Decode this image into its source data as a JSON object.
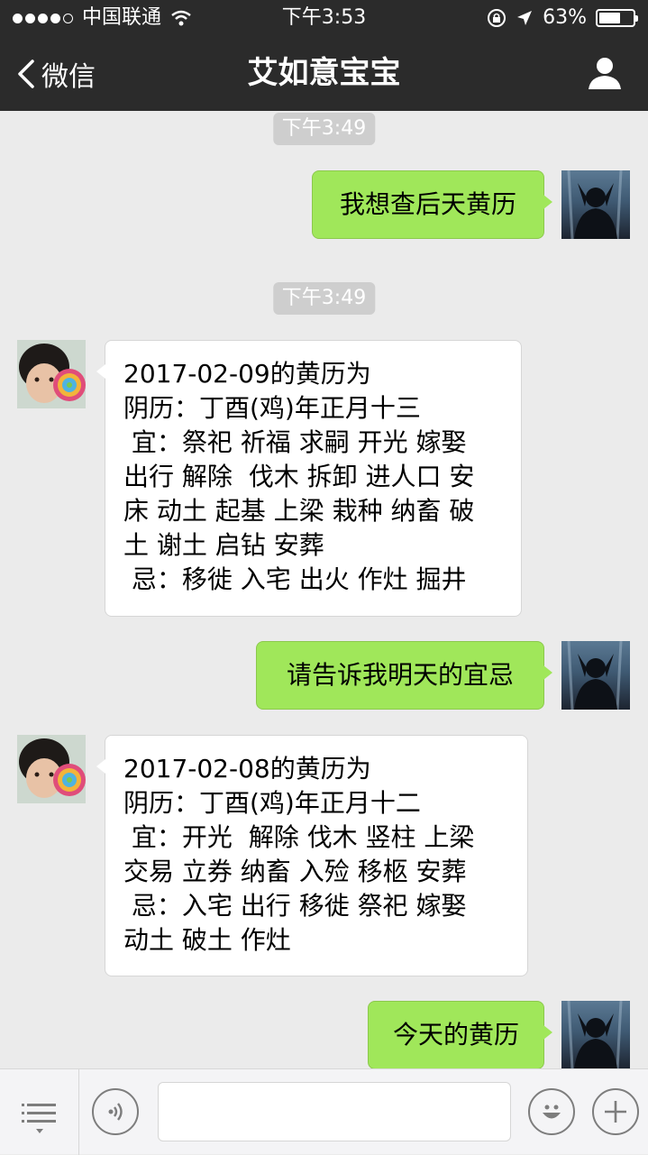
{
  "status_bar": {
    "carrier": "中国联通",
    "time": "下午3:53",
    "battery": "63%",
    "battery_level": 0.63,
    "signal_bars": 4
  },
  "nav": {
    "back_label": "微信",
    "title": "艾如意宝宝"
  },
  "messages": {
    "time1": "下午3:49",
    "m1": "我想查后天黄历",
    "time2": "下午3:49",
    "r1": "2017-02-09的黄历为\n阴历：丁酉(鸡)年正月十三\n 宜：祭祀 祈福 求嗣 开光 嫁娶\n出行 解除  伐木 拆卸 进人口 安\n床 动土 起基 上梁 栽种 纳畜 破\n土 谢土 启钻 安葬\n 忌：移徙 入宅 出火 作灶 掘井",
    "m2": "请告诉我明天的宜忌",
    "r2": "2017-02-08的黄历为\n阴历：丁酉(鸡)年正月十二\n 宜：开光  解除 伐木 竖柱 上梁\n交易 立券 纳畜 入殓 移柩 安葬\n 忌：入宅 出行 移徙 祭祀 嫁娶\n动土 破土 作灶",
    "m3": "今天的黄历"
  },
  "icons": {
    "back": "chevron-left-icon",
    "profile": "person-icon",
    "menu": "menu-icon",
    "voice": "voice-icon",
    "emoji": "emoji-icon",
    "add": "plus-icon"
  },
  "colors": {
    "nav_bg": "#2b2b2b",
    "chat_bg": "#ebebeb",
    "outgoing_bubble": "#a0e75a",
    "incoming_bubble": "#ffffff"
  }
}
